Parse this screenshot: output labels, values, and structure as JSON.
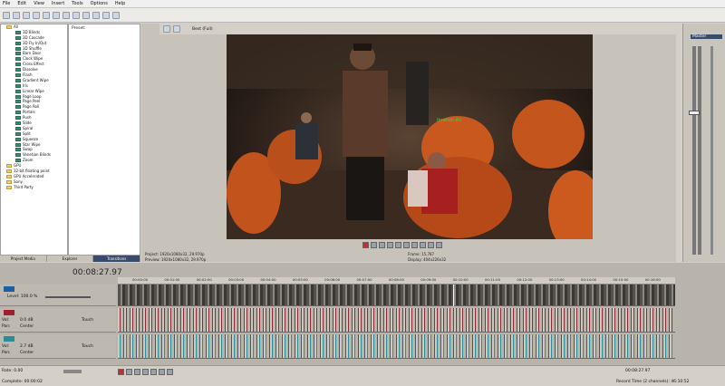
{
  "menu": [
    "File",
    "Edit",
    "View",
    "Insert",
    "Tools",
    "Options",
    "Help"
  ],
  "tree_items": [
    {
      "label": "All",
      "kind": "fold"
    },
    {
      "label": "3D Blinds",
      "kind": "fx"
    },
    {
      "label": "3D Cascade",
      "kind": "fx"
    },
    {
      "label": "3D Fly In/Out",
      "kind": "fx"
    },
    {
      "label": "3D Shuffle",
      "kind": "fx"
    },
    {
      "label": "Barn Door",
      "kind": "fx"
    },
    {
      "label": "Clock Wipe",
      "kind": "fx"
    },
    {
      "label": "Cross Effect",
      "kind": "fx"
    },
    {
      "label": "Dissolve",
      "kind": "fx"
    },
    {
      "label": "Flash",
      "kind": "fx"
    },
    {
      "label": "Gradient Wipe",
      "kind": "fx"
    },
    {
      "label": "Iris",
      "kind": "fx"
    },
    {
      "label": "Linear Wipe",
      "kind": "fx"
    },
    {
      "label": "Page Loop",
      "kind": "fx"
    },
    {
      "label": "Page Peel",
      "kind": "fx"
    },
    {
      "label": "Page Roll",
      "kind": "fx"
    },
    {
      "label": "Portals",
      "kind": "fx"
    },
    {
      "label": "Push",
      "kind": "fx"
    },
    {
      "label": "Slide",
      "kind": "fx"
    },
    {
      "label": "Spiral",
      "kind": "fx"
    },
    {
      "label": "Split",
      "kind": "fx"
    },
    {
      "label": "Squeeze",
      "kind": "fx"
    },
    {
      "label": "Star Wipe",
      "kind": "fx"
    },
    {
      "label": "Swap",
      "kind": "fx"
    },
    {
      "label": "Venetian Blinds",
      "kind": "fx"
    },
    {
      "label": "Zoom",
      "kind": "fx"
    },
    {
      "label": "GPU",
      "kind": "fold"
    },
    {
      "label": "32-bit floating point",
      "kind": "fold"
    },
    {
      "label": "GPU Accelerated",
      "kind": "fold"
    },
    {
      "label": "Sony",
      "kind": "fold"
    },
    {
      "label": "Third Party",
      "kind": "fold"
    }
  ],
  "presets_header": "Preset:",
  "pane_tabs": [
    "Project Media",
    "Explorer",
    "Transitions"
  ],
  "preview_quality": "Best (Full)",
  "preview_info": {
    "project": "Project: 1920x1080x32, 29.970p",
    "preview": "Preview: 1920x1080x32, 29.970p",
    "frame": "Frame: 15,787",
    "display": "Display: 404x226x32"
  },
  "master_label": "Master",
  "timecode": "00:08:27.97",
  "ruler_ticks": [
    "00:00:00",
    "00:01:00",
    "00:02:00",
    "00:03:00",
    "00:04:00",
    "00:05:00",
    "00:06:00",
    "00:07:00",
    "00:08:00",
    "00:09:00",
    "00:10:00",
    "00:11:00",
    "00:12:00",
    "00:13:00",
    "00:14:00",
    "00:15:00",
    "00:16:00"
  ],
  "video_track": {
    "level_label": "Level: 100.0 %"
  },
  "audio_tracks": [
    {
      "vol": "0.0 dB",
      "pan": "Center",
      "mode": "Touch",
      "num": "2"
    },
    {
      "vol": "2.7 dB",
      "pan": "Center",
      "mode": "Touch",
      "num": "3"
    }
  ],
  "rate_label": "Rate: 0.00",
  "end_timecode": "00:08:27.97",
  "status_left": "Complete: 00:00:02",
  "status_right": "Record Time (2 channels): 46:10:52",
  "overlay_name": "Ibrahim Ali",
  "colors": {
    "audio_wave": "#8b2a35",
    "audio_wave2": "#2b8c9a",
    "video_bg": "#2a2019"
  }
}
